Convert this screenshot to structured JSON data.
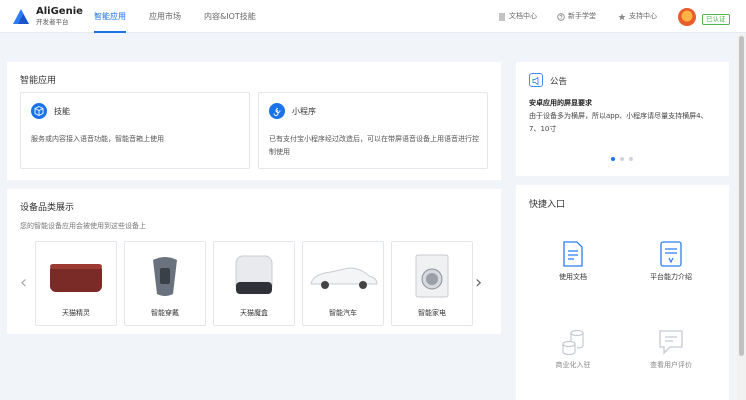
{
  "header": {
    "brand_name": "AliGenie",
    "brand_sub": "开发者平台",
    "nav": [
      {
        "label": "智能应用"
      },
      {
        "label": "应用市场"
      },
      {
        "label": "内容&IOT技能"
      }
    ],
    "links": [
      {
        "label": "文档中心",
        "icon": "doc-icon"
      },
      {
        "label": "新手学堂",
        "icon": "question-circle-icon"
      },
      {
        "label": "支持中心",
        "icon": "star-icon"
      }
    ],
    "verified_badge": "已认证"
  },
  "apps": {
    "title": "智能应用",
    "items": [
      {
        "title": "技能",
        "desc": "服务或内容接入语音功能，智能音箱上使用",
        "icon": "cube-icon"
      },
      {
        "title": "小程序",
        "desc": "已有支付宝小程序经过改造后，可以在带屏语音设备上用语音进行控制使用",
        "icon": "mini-program-icon"
      }
    ]
  },
  "devices": {
    "title": "设备品类展示",
    "desc": "您的智能设备应用会被使用到这些设备上",
    "items": [
      {
        "label": "天猫精灵"
      },
      {
        "label": "智能穿戴"
      },
      {
        "label": "天猫魔盒"
      },
      {
        "label": "智能汽车"
      },
      {
        "label": "智能家电"
      }
    ]
  },
  "notice": {
    "title": "公告",
    "headline": "安卓应用的屏显要求",
    "body": "由于设备多为横屏，所以app、小程序请尽量支持横屏4、7、10寸",
    "dots": 3,
    "active_dot": 0
  },
  "quick": {
    "title": "快捷入口",
    "items": [
      {
        "label": "使用文档",
        "icon": "document-icon",
        "enabled": true
      },
      {
        "label": "平台能力介绍",
        "icon": "certificate-icon",
        "enabled": true
      },
      {
        "label": "商业化入驻",
        "icon": "coins-icon",
        "enabled": false
      },
      {
        "label": "查看用户评价",
        "icon": "comment-icon",
        "enabled": false
      }
    ]
  },
  "colors": {
    "accent": "#1a73e8",
    "background": "#f1f4f9",
    "verified": "#52b54b"
  }
}
